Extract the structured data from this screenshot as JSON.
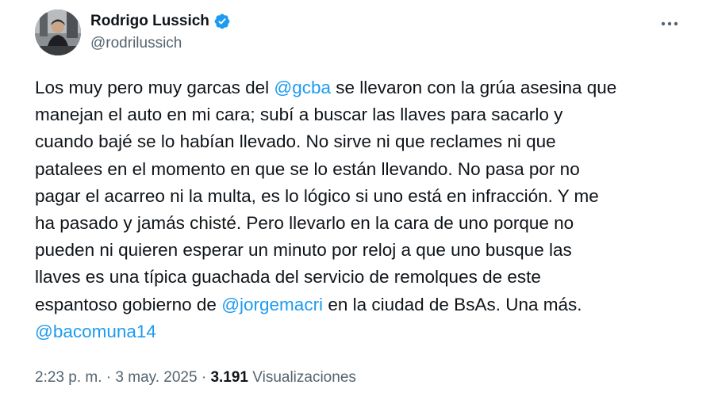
{
  "author": {
    "display_name": "Rodrigo Lussich",
    "handle": "@rodrilussich",
    "verified_color": "#1d9bf0"
  },
  "menu": {
    "more_icon": "more-horizontal-icon"
  },
  "tweet": {
    "lines": [
      [
        {
          "text": "Los muy pero muy garcas del "
        },
        {
          "text": "@gcba",
          "mention": true
        },
        {
          "text": " se llevaron con la grúa asesina que"
        }
      ],
      [
        {
          "text": "manejan el auto en mi cara; subí a buscar las llaves para sacarlo y"
        }
      ],
      [
        {
          "text": "cuando bajé se lo habían llevado. No sirve ni que reclames ni que"
        }
      ],
      [
        {
          "text": "patalees en el momento en que se lo están llevando. No pasa por no"
        }
      ],
      [
        {
          "text": "pagar el acarreo ni la multa, es lo lógico si uno está en infracción. Y me"
        }
      ],
      [
        {
          "text": "ha pasado y jamás chisté. Pero llevarlo en la cara de uno porque no"
        }
      ],
      [
        {
          "text": "pueden ni quieren esperar un minuto por reloj a que uno busque las"
        }
      ],
      [
        {
          "text": "llaves es una típica guachada del servicio de remolques de este"
        }
      ],
      [
        {
          "text": "espantoso gobierno de "
        },
        {
          "text": "@jorgemacri",
          "mention": true
        },
        {
          "text": " en la ciudad de BsAs. Una más."
        }
      ],
      [
        {
          "text": "@bacomuna14",
          "mention": true
        }
      ]
    ]
  },
  "meta": {
    "time": "2:23 p. m.",
    "separator": " · ",
    "date": "3 may. 2025",
    "views_count": "3.191",
    "views_label": "Visualizaciones"
  },
  "colors": {
    "link": "#1d9bf0",
    "text": "#0f1419",
    "secondary": "#536471"
  }
}
